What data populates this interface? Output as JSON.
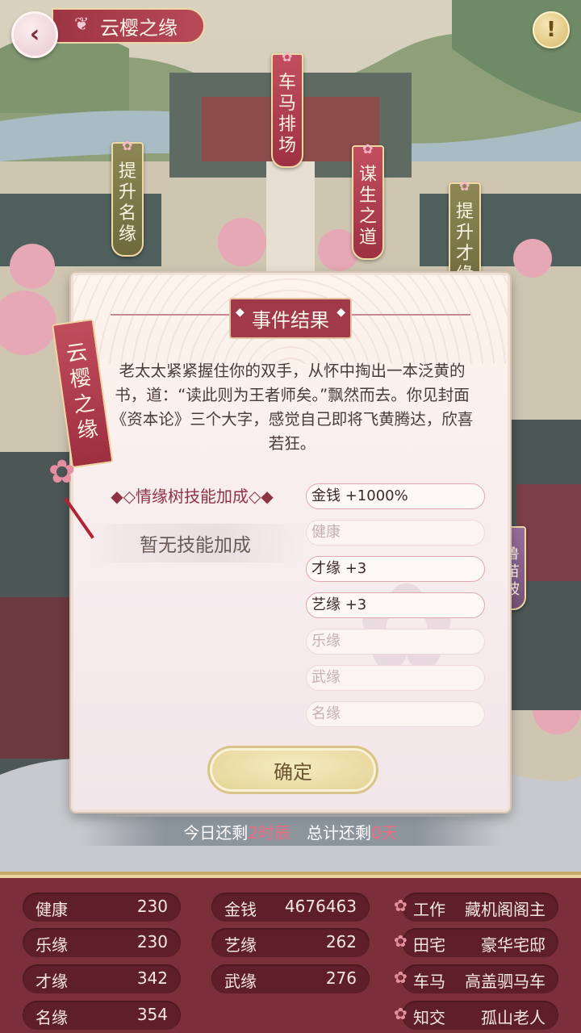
{
  "header": {
    "title": "云樱之缘",
    "info_label": "!"
  },
  "map_banners": [
    {
      "label": "车马排场"
    },
    {
      "label": "提升名缘"
    },
    {
      "label": "谋生之道"
    },
    {
      "label": "提升才缘"
    },
    {
      "label": "鲁苗坡"
    }
  ],
  "dialog": {
    "title": "事件结果",
    "text": "老太太紧紧握住你的双手，从怀中掏出一本泛黄的书，道：“读此则为王者师矣。”飘然而去。你见封面《资本论》三个大字，感觉自己即将飞黄腾达，欣喜若狂。",
    "tassel_label": "云樱之缘",
    "skill_section_label": "◆◇情缘树技能加成◇◆",
    "no_skill_text": "暂无技能加成",
    "rewards": [
      {
        "text": "金钱 +1000%",
        "active": true
      },
      {
        "text": "健康",
        "active": false
      },
      {
        "text": "才缘 +3",
        "active": true
      },
      {
        "text": "艺缘 +3",
        "active": true
      },
      {
        "text": "乐缘",
        "active": false
      },
      {
        "text": "武缘",
        "active": false
      },
      {
        "text": "名缘",
        "active": false
      }
    ],
    "confirm_label": "确定"
  },
  "timebar": {
    "prefix1": "今日还剩",
    "value1": "2时辰",
    "prefix2": "总计还剩",
    "value2": "0天"
  },
  "stats": {
    "col1": [
      {
        "key": "健康",
        "value": "230"
      },
      {
        "key": "乐缘",
        "value": "230"
      },
      {
        "key": "才缘",
        "value": "342"
      },
      {
        "key": "名缘",
        "value": "354"
      }
    ],
    "col2": [
      {
        "key": "金钱",
        "value": "4676463"
      },
      {
        "key": "艺缘",
        "value": "262"
      },
      {
        "key": "武缘",
        "value": "276"
      }
    ],
    "col3": [
      {
        "key": "工作",
        "value": "藏机阁阁主"
      },
      {
        "key": "田宅",
        "value": "豪华宅邸"
      },
      {
        "key": "车马",
        "value": "高盖驷马车"
      },
      {
        "key": "知交",
        "value": "孤山老人"
      }
    ]
  },
  "colors": {
    "accent_red": "#a03a4b",
    "panel_bg": "#7a2f3a",
    "highlight": "#f06a82",
    "button_gold": "#e4d394"
  }
}
